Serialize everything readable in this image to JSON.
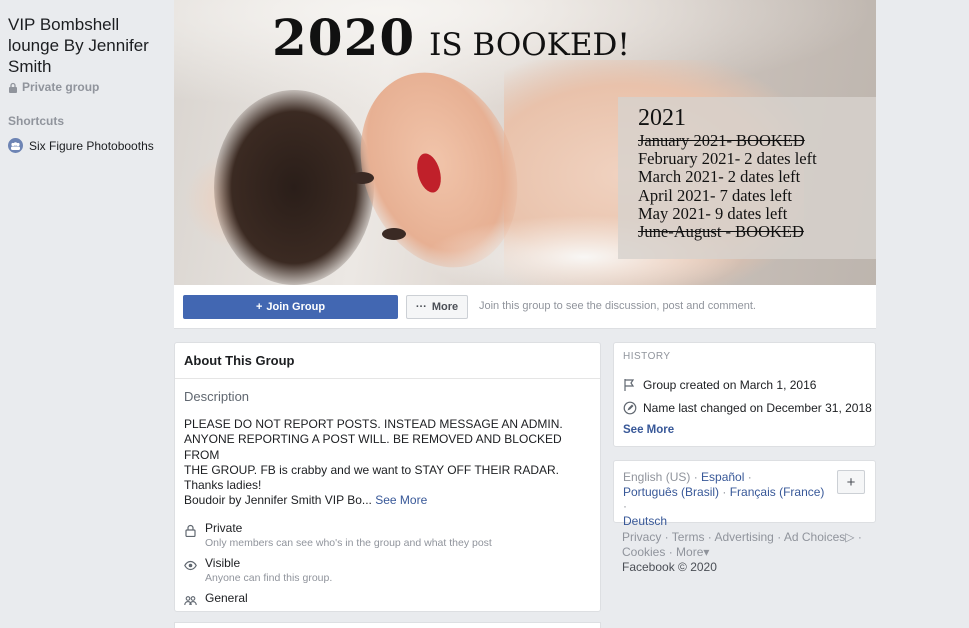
{
  "sidebar": {
    "group_name": "VIP Bombshell lounge By Jennifer Smith",
    "privacy": "Private group",
    "shortcuts_heading": "Shortcuts",
    "shortcut_item": "Six Figure Photobooths"
  },
  "cover": {
    "year_text": "2020",
    "booked_text": "IS BOOKED!",
    "schedule_year": "2021",
    "schedule_lines": [
      "January 2021- BOOKED",
      "February 2021- 2 dates left",
      "March 2021- 2 dates left",
      "April 2021- 7 dates left",
      "May 2021- 9 dates left",
      "June-August - BOOKED"
    ]
  },
  "actions": {
    "join_label": "Join Group",
    "more_label": "More",
    "join_hint": "Join this group to see the discussion, post and comment."
  },
  "about": {
    "heading": "About This Group",
    "description_heading": "Description",
    "description_lines": [
      "PLEASE DO NOT REPORT POSTS.  INSTEAD MESSAGE AN ADMIN.",
      "ANYONE REPORTING A POST WILL. BE REMOVED AND BLOCKED FROM",
      "THE GROUP.  FB is crabby and we want to STAY OFF THEIR RADAR.",
      "Thanks ladies!"
    ],
    "description_preview": "Boudoir by Jennifer Smith VIP Bo...",
    "see_more": "See More",
    "private_title": "Private",
    "private_sub": "Only members can see who's in the group and what they post",
    "visible_title": "Visible",
    "visible_sub": "Anyone can find this group.",
    "general_title": "General"
  },
  "history": {
    "heading": "HISTORY",
    "created": "Group created on March 1, 2016",
    "renamed": "Name last changed on December 31, 2018",
    "see_more": "See More"
  },
  "languages": {
    "current": "English (US)",
    "options": [
      "Español",
      "Português (Brasil)",
      "Français (France)",
      "Deutsch"
    ],
    "add_label": "+"
  },
  "footer": {
    "links": [
      "Privacy",
      "Terms",
      "Advertising",
      "Ad Choices",
      "Cookies",
      "More"
    ],
    "copyright": "Facebook © 2020"
  },
  "colors": {
    "brand_blue": "#4267b2",
    "link_blue": "#385898",
    "page_bg": "#e9ebee"
  }
}
